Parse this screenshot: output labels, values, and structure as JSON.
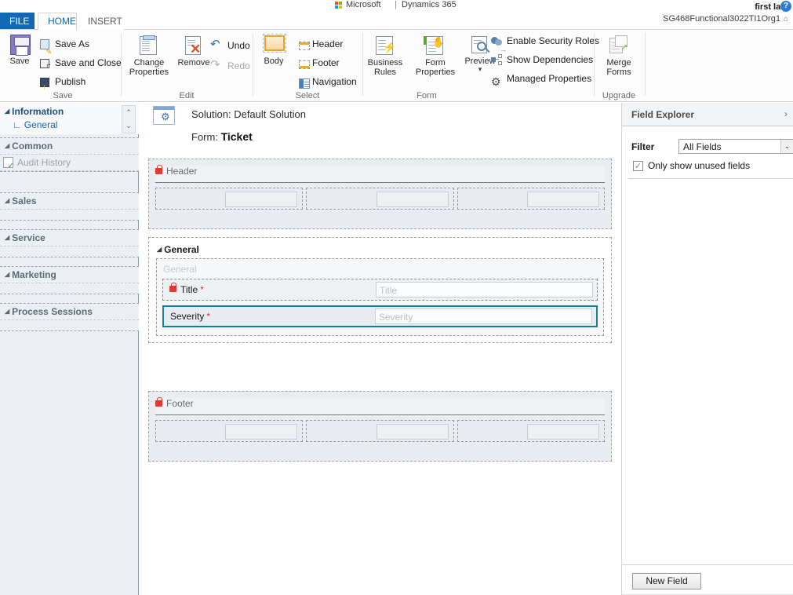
{
  "brand": {
    "logo_icon": "microsoft-logo-icon",
    "company": "Microsoft",
    "separator": "|",
    "product": "Dynamics 365"
  },
  "user": {
    "name": "first last",
    "org": "SG468Functional3022TI1Org1",
    "help_icon": "help-icon",
    "help_glyph": "?",
    "org_caret_glyph": "⌂"
  },
  "tabs": [
    {
      "label": "FILE",
      "id": "file"
    },
    {
      "label": "HOME",
      "id": "home"
    },
    {
      "label": "INSERT",
      "id": "insert"
    }
  ],
  "ribbon": {
    "groups": [
      {
        "name": "Save",
        "label": "Save",
        "big": [
          {
            "label": "Save",
            "icon": "floppy-disk-icon"
          }
        ],
        "small": [
          {
            "label": "Save As",
            "icon": "save-as-icon",
            "disabled": false
          },
          {
            "label": "Save and Close",
            "icon": "save-and-close-icon",
            "disabled": false
          },
          {
            "label": "Publish",
            "icon": "publish-icon",
            "disabled": false
          }
        ]
      },
      {
        "name": "Edit",
        "label": "Edit",
        "big": [
          {
            "label": "Change Properties",
            "icon": "change-properties-icon"
          },
          {
            "label": "Remove",
            "icon": "remove-icon"
          }
        ],
        "small": [
          {
            "label": "Undo",
            "icon": "undo-arrow-icon",
            "disabled": false
          },
          {
            "label": "Redo",
            "icon": "redo-arrow-icon",
            "disabled": true
          }
        ]
      },
      {
        "name": "Select",
        "label": "Select",
        "big": [
          {
            "label": "Body",
            "icon": "body-icon"
          }
        ],
        "small": [
          {
            "label": "Header",
            "icon": "header-icon",
            "disabled": false
          },
          {
            "label": "Footer",
            "icon": "footer-icon",
            "disabled": false
          },
          {
            "label": "Navigation",
            "icon": "navigation-icon",
            "disabled": false
          }
        ]
      },
      {
        "name": "Form",
        "label": "Form",
        "big": [
          {
            "label": "Business Rules",
            "icon": "business-rules-icon"
          },
          {
            "label": "Form Properties",
            "icon": "form-properties-icon"
          },
          {
            "label": "Preview",
            "icon": "preview-icon",
            "has_dropdown": true
          }
        ],
        "small": [
          {
            "label": "Enable Security Roles",
            "icon": "security-roles-icon",
            "disabled": false
          },
          {
            "label": "Show Dependencies",
            "icon": "dependencies-icon",
            "disabled": false
          },
          {
            "label": "Managed Properties",
            "icon": "gear-icon",
            "disabled": false
          }
        ]
      },
      {
        "name": "Upgrade",
        "label": "Upgrade",
        "big": [
          {
            "label": "Merge Forms",
            "icon": "merge-forms-icon"
          }
        ],
        "small": []
      }
    ]
  },
  "leftnav": {
    "information": {
      "title": "Information",
      "sub": "General",
      "elbow_glyph": "∟",
      "scroll_up_glyph": "⌃",
      "scroll_down_glyph": "⌄"
    },
    "sections": [
      {
        "title": "Common",
        "items": [
          {
            "label": "Audit History",
            "icon": "audit-history-icon"
          }
        ]
      },
      {
        "title": "Sales",
        "items": []
      },
      {
        "title": "Service",
        "items": []
      },
      {
        "title": "Marketing",
        "items": []
      },
      {
        "title": "Process Sessions",
        "items": []
      }
    ]
  },
  "canvas": {
    "solution_icon": "solution-gear-icon",
    "solution_line": "Solution: Default Solution",
    "form_prefix": "Form: ",
    "form_name": "Ticket",
    "header_section": {
      "label": "Header",
      "lock_icon": "lock-icon",
      "cells": 3
    },
    "tab_section": {
      "title": "General",
      "section_label": "General",
      "fields": [
        {
          "label": "Title",
          "required": "*",
          "placeholder": "Title",
          "locked": true,
          "selected": false
        },
        {
          "label": "Severity",
          "required": "*",
          "placeholder": "Severity",
          "locked": false,
          "selected": true
        }
      ]
    },
    "footer_section": {
      "label": "Footer",
      "lock_icon": "lock-icon",
      "cells": 3
    }
  },
  "field_explorer": {
    "title": "Field Explorer",
    "expand_glyph": "›",
    "filter_label": "Filter",
    "filter_value": "All Fields",
    "filter_arrow_glyph": "⌄",
    "checkbox_checked": true,
    "checkbox_glyph": "✓",
    "checkbox_label": "Only show unused fields",
    "new_field_button": "New Field"
  },
  "colors": {
    "accent_blue": "#1268b3",
    "file_tab_blue": "#1268b3",
    "selection_teal": "#1b7d9e",
    "required_red": "#c0392b",
    "lock_red": "#e03a33"
  }
}
